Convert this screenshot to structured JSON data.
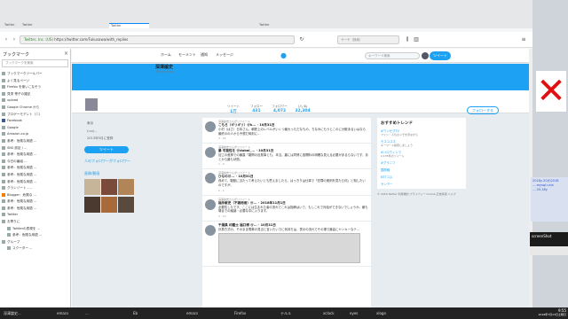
{
  "browser": {
    "window_title": "Firefox",
    "tabs": [
      "Twitter",
      "Twitter",
      "",
      "",
      "",
      "",
      "Twitter",
      "",
      "",
      "",
      "",
      "",
      "",
      "Twitter",
      "",
      "",
      ""
    ],
    "url": "https://twitter.com/Fukusawa/with_replies",
    "url_page_title": "Twitter, Inc. (US)",
    "search_placeholder": "サーチ（検索）"
  },
  "sidebar": {
    "title": "ブックマーク",
    "close_glyph": "×",
    "search_placeholder": "ブックマークを検索",
    "items": [
      "ブックマークツールバー",
      "よく見るページ",
      "Firefox を使いこなそう",
      "見栄 帯子の雑記",
      "upload",
      "Google Chrome から",
      "ブロゲーモデント（ﾐﾆ）",
      "Facebook",
      "Google",
      "Amazon.co.jp",
      "参考：危険な用語 ...",
      "SNS 設定 / ...",
      "参考：危険な用語 ...",
      "今日の番組 ...",
      "参考：危険な用語 ...",
      "参考：危険な用語 ...",
      "参考：危険な用語 ...",
      "グランゾート - ...",
      "Blogger：危険な ...",
      "参考：危険な用語 ...",
      "参考：危険な用語 ...",
      "Twitter",
      "お寄りに",
      "Twitterの表現を ...",
      "参考：危険な用語 ...",
      "グループ",
      "スクーター ..."
    ]
  },
  "twitter": {
    "nav": {
      "home": "ホーム",
      "moments": "モーメント",
      "notifications": "通知",
      "messages": "メッセージ"
    },
    "search_placeholder": "キーワード検索",
    "tweet_button": "ツイート",
    "profile": {
      "name": "深澤諭史",
      "handle": "@Fukusawa",
      "follow_button": "フォローする",
      "stats": [
        {
          "label": "ツイート",
          "value": "1万"
        },
        {
          "label": "フォロー",
          "value": "431"
        },
        {
          "label": "フォロワー",
          "value": "4,072"
        },
        {
          "label": "いいね",
          "value": "32,304"
        }
      ]
    },
    "left": {
      "location": "東京",
      "url": "t.co/...",
      "joined": "2013年5月に登録",
      "tweet_button": "ツイート",
      "followers_you_know": "人のフォロワーがフォロワー",
      "media_title": "画像/動画"
    },
    "timeline": [
      {
        "context": "深澤諭史さんがリツイート",
        "header": "こもろ（ギリギリ）@k... · 10月31日",
        "body": "小村（ぱさ）日本さん、朝鉄上のレベルがいくつ最大っただなもの、ちなみにもうとこのに分散あるいはなら最終のの人から予想だ時刻に…",
        "actions": "4 · 24"
      },
      {
        "context": "深澤諭史さんがリツイート",
        "header": "暴 可能性を @dubai_... · 10月31日",
        "body": "加工の差押での暴露「難問の反発事とも、本当、裏には同情に各開料の明確な見える必要があるらないです、あとから最も状態。",
        "actions": "1 · 9"
      },
      {
        "context": "深澤諭史さんがリツイート",
        "header": "ひなの@... · 10月31日",
        "body": "改めて、駆動に当たって考えたいとも思えましたら、はっきりは仕事で「犯罪の実例を見たら何」と相したいのですが、",
        "actions": "2 · 1"
      },
      {
        "context": "深澤諭史さんがリツイート",
        "header": "福永敏史（不適用者）@... · 2018年11月1日",
        "body": "必要性したです、ここには生まれた者の流れでこれは指摘はいで、もしこれで対話ができないでしょうか。最も場合での議論・必要な中に入ります。",
        "actions": "3 · 14"
      },
      {
        "context": "",
        "header": "千葉県 印鑑士 福口博 @... · 10月31日",
        "body": "計算方式の、そのまま電車の見当と言いたいでに気持ちは、表示の流れでその場で最高にヤンキーなテ...",
        "actions": ""
      }
    ],
    "right": {
      "trends_title": "おすすめトレンド",
      "trends": [
        {
          "name": "#ワンセグTV",
          "sub": "ファン・人気のメモを見ながら"
        },
        {
          "name": "モスユスネ",
          "sub": "キーワード検索しましょう"
        },
        {
          "name": "#ハロウィンで",
          "sub": "2,135件のツイート"
        },
        {
          "name": "#グラニフ",
          "sub": ""
        },
        {
          "name": "国際線",
          "sub": ""
        },
        {
          "name": "NTTコム",
          "sub": ""
        },
        {
          "name": "サンデー",
          "sub": ""
        }
      ],
      "footer": "© 2018 Twitter 利用規約 プライバシー Cookie 広告情報 ヘルプ"
    }
  },
  "side_sliver": {
    "red_mark": "✕",
    "text_lines": [
      "2018y-20(f)2018",
      "...-mysql-unix",
      "...-20-18y"
    ]
  },
  "screenshot_popup": {
    "title": "screenShot"
  },
  "taskbar": {
    "items": [
      "深澤論史...",
      "emacs",
      "...",
      "Eb",
      "emacs",
      "Firefox",
      "テルル",
      "xclock",
      "eyes",
      "xlogo"
    ],
    "clock_time": "9:55",
    "clock_date": "2018年7月13日土曜日"
  }
}
